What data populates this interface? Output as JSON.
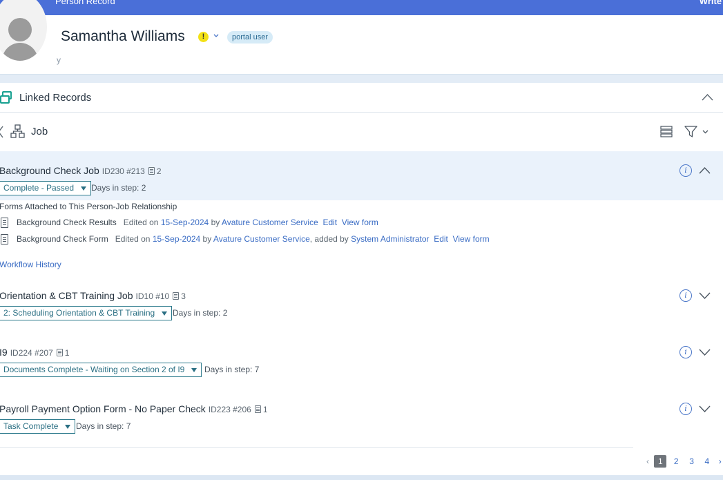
{
  "topbar": {
    "crumb": "Person Record",
    "action": "Write t"
  },
  "person": {
    "name": "Samantha Williams",
    "alert": "!",
    "badge": "portal user",
    "ghost": "y"
  },
  "section": {
    "title": "Linked Records",
    "subsection": "Job"
  },
  "jobs": [
    {
      "title": "Background Check Job",
      "meta": "ID230 #213",
      "count": "2",
      "status": "Complete - Passed",
      "days": "Days in step: 2",
      "expanded": true
    },
    {
      "title": "Orientation & CBT Training Job",
      "meta": "ID10 #10",
      "count": "3",
      "status": "2: Scheduling Orientation & CBT Training",
      "days": "Days in step: 2",
      "expanded": false
    },
    {
      "title": "I9",
      "meta": "ID224 #207",
      "count": "1",
      "status": "Documents Complete - Waiting on Section 2 of I9",
      "days": "Days in step: 7",
      "expanded": false
    },
    {
      "title": "Payroll Payment Option Form - No Paper Check",
      "meta": "ID223 #206",
      "count": "1",
      "status": "Task Complete",
      "days": "Days in step: 7",
      "expanded": false
    }
  ],
  "forms": {
    "title": "Forms Attached to This Person-Job Relationship",
    "rows": [
      {
        "name": "Background Check Results",
        "edited": "Edited on",
        "date": "15-Sep-2024",
        "by": "by",
        "user": "Avature Customer Service",
        "added_by": "",
        "added_user": "",
        "edit": "Edit",
        "view": "View form"
      },
      {
        "name": "Background Check Form",
        "edited": "Edited on",
        "date": "15-Sep-2024",
        "by": "by",
        "user": "Avature Customer Service",
        "added_by": ", added by",
        "added_user": "System Administrator",
        "edit": "Edit",
        "view": "View form"
      }
    ],
    "workflow": "Workflow History"
  },
  "pager": {
    "prev": "‹",
    "pages": [
      "1",
      "2",
      "3",
      "4"
    ],
    "current": "1",
    "next": "›"
  },
  "icons": {
    "info": "i",
    "colors": {
      "accent": "#4a6fd8",
      "link": "#3a6cc4",
      "teal": "#2c7a8c",
      "highlight": "#eaf2fb"
    }
  }
}
